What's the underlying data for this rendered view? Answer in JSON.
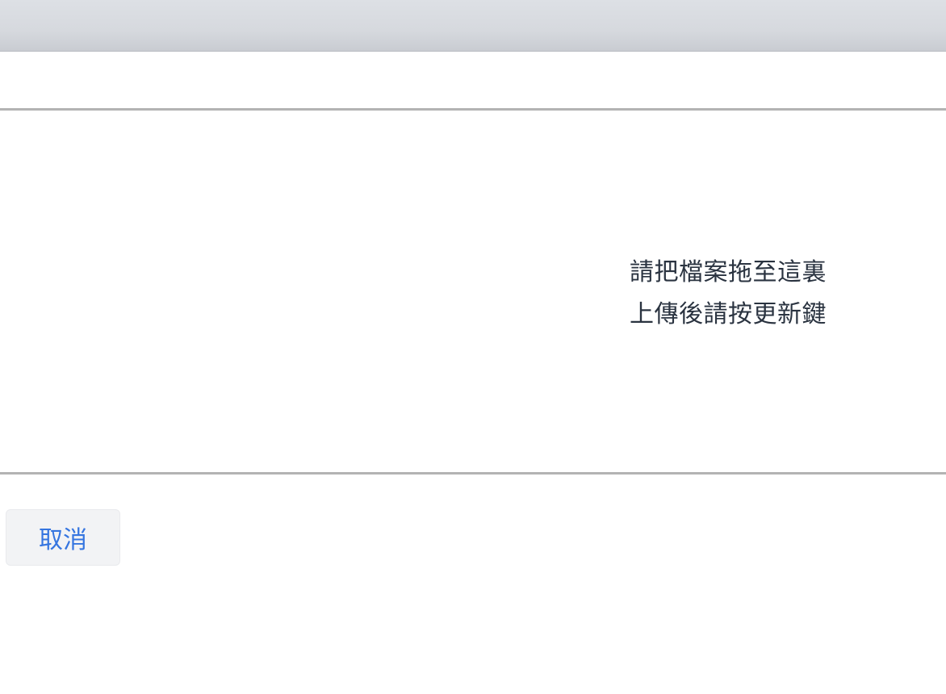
{
  "dropzone": {
    "line1": "請把檔案拖至這裏",
    "line2": "上傳後請按更新鍵"
  },
  "footer": {
    "cancel_label": "取消"
  },
  "colors": {
    "accent": "#3575e0",
    "text": "#2a3340",
    "divider": "#b3b3b3",
    "button_bg": "#f2f3f5"
  }
}
